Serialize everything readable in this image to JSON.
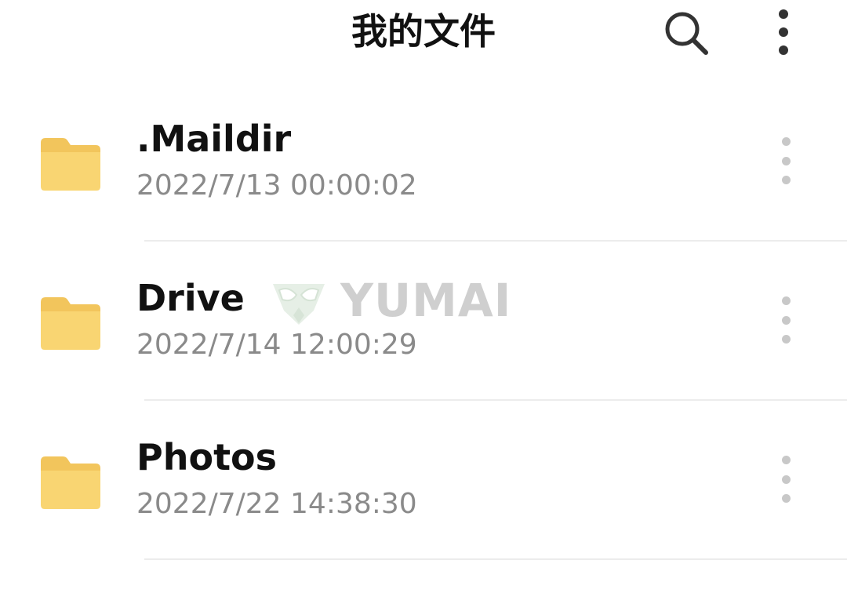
{
  "header": {
    "title": "我的文件",
    "search_icon": "search-icon",
    "more_icon": "more-vertical-icon"
  },
  "files": [
    {
      "name": ".Maildir",
      "modified": "2022/7/13 00:00:02",
      "icon": "folder-icon"
    },
    {
      "name": "Drive",
      "modified": "2022/7/14 12:00:29",
      "icon": "folder-icon"
    },
    {
      "name": "Photos",
      "modified": "2022/7/22 14:38:30",
      "icon": "folder-icon"
    }
  ],
  "watermark": {
    "text": "YUMAI"
  },
  "colors": {
    "folder_front": "#F9D572",
    "folder_back": "#F2C55C",
    "title_text": "#111111",
    "date_text": "#8A8A8A",
    "divider": "#ECECEC",
    "row_menu_dots": "#C8C8C8"
  }
}
